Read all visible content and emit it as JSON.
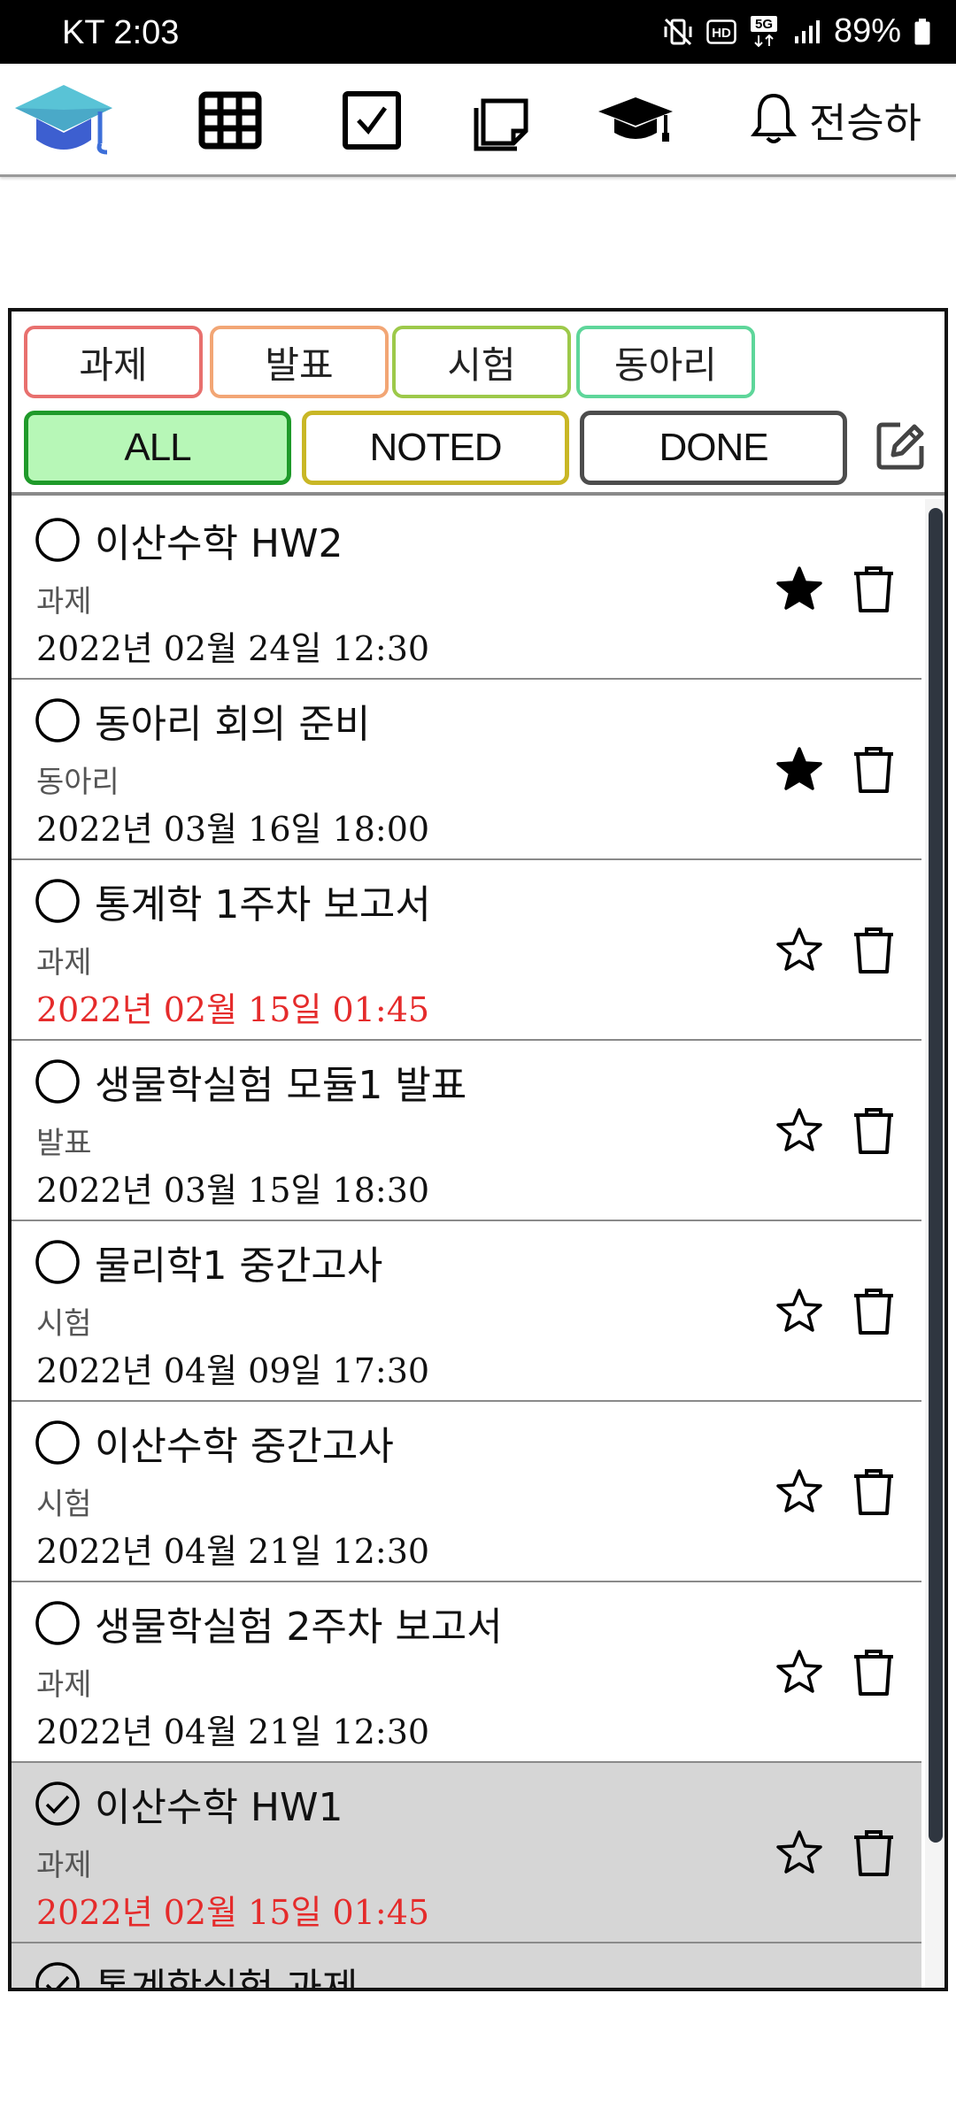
{
  "status_bar": {
    "carrier_time": "KT 2:03",
    "hd_label": "HD",
    "network_label": "5G",
    "battery": "89%"
  },
  "app_bar": {
    "user_name": "전승하",
    "icons": [
      "graduation-cap-logo",
      "grid-icon",
      "checkbox-icon",
      "note-icon",
      "graduation-cap-icon",
      "bell-icon"
    ]
  },
  "filters": {
    "categories": [
      {
        "label": "과제",
        "color": "#e8706e"
      },
      {
        "label": "발표",
        "color": "#f2a675"
      },
      {
        "label": "시험",
        "color": "#9dc94a"
      },
      {
        "label": "동아리",
        "color": "#5ed69a"
      }
    ],
    "statuses": [
      {
        "label": "ALL",
        "border": "#1f9a2a",
        "fill": "#b7f7b7",
        "selected": true
      },
      {
        "label": "NOTED",
        "border": "#c9b726",
        "fill": "#ffffff",
        "selected": false
      },
      {
        "label": "DONE",
        "border": "#4d4d4d",
        "fill": "#ffffff",
        "selected": false
      }
    ]
  },
  "tasks": [
    {
      "title": "이산수학 HW2",
      "category": "과제",
      "date": "2022년 02월 24일 12:30",
      "overdue": false,
      "starred": true,
      "done": false
    },
    {
      "title": "동아리 회의 준비",
      "category": "동아리",
      "date": "2022년 03월 16일 18:00",
      "overdue": false,
      "starred": true,
      "done": false
    },
    {
      "title": "통계학 1주차 보고서",
      "category": "과제",
      "date": "2022년 02월 15일 01:45",
      "overdue": true,
      "starred": false,
      "done": false
    },
    {
      "title": "생물학실험 모듈1 발표",
      "category": "발표",
      "date": "2022년 03월 15일 18:30",
      "overdue": false,
      "starred": false,
      "done": false
    },
    {
      "title": "물리학1 중간고사",
      "category": "시험",
      "date": "2022년 04월 09일 17:30",
      "overdue": false,
      "starred": false,
      "done": false
    },
    {
      "title": "이산수학 중간고사",
      "category": "시험",
      "date": "2022년 04월 21일 12:30",
      "overdue": false,
      "starred": false,
      "done": false
    },
    {
      "title": "생물학실험 2주차 보고서",
      "category": "과제",
      "date": "2022년 04월 21일 12:30",
      "overdue": false,
      "starred": false,
      "done": false
    },
    {
      "title": "이산수학 HW1",
      "category": "과제",
      "date": "2022년 02월 15일 01:45",
      "overdue": true,
      "starred": false,
      "done": true
    },
    {
      "title": "통계학실험 과제",
      "category": "",
      "date": "",
      "overdue": false,
      "starred": false,
      "done": true
    }
  ],
  "colors": {
    "overdue_text": "#e52b2b",
    "done_row_bg": "#d6d6d6",
    "logo_blue": "#3d6fd9",
    "logo_teal": "#59c3d6"
  }
}
